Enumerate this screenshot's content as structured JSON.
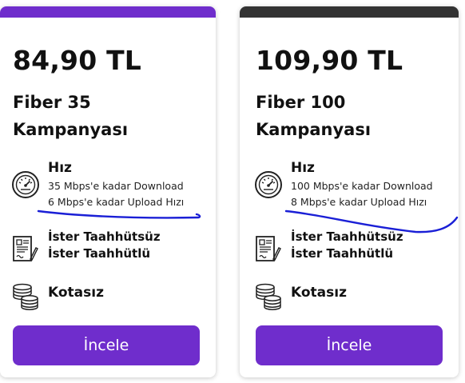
{
  "colors": {
    "accent": "#6f2dcc",
    "card2_topbar": "#333333",
    "annotation": "#1a1fd6"
  },
  "cards": [
    {
      "price": "84,90 TL",
      "title_line1": "Fiber 35",
      "title_line2": "Kampanyası",
      "speed": {
        "heading": "Hız",
        "download": "35 Mbps'e kadar Download",
        "upload": "6 Mbps'e kadar Upload Hızı"
      },
      "contract": {
        "line1": "İster Taahhütsüz",
        "line2": "İster Taahhütlü"
      },
      "quota": "Kotasız",
      "button": "İncele",
      "icons": [
        "speedometer-icon",
        "contract-icon",
        "coins-icon"
      ]
    },
    {
      "price": "109,90 TL",
      "title_line1": "Fiber 100",
      "title_line2": "Kampanyası",
      "speed": {
        "heading": "Hız",
        "download": "100 Mbps'e kadar Download",
        "upload": "8 Mbps'e kadar Upload Hızı"
      },
      "contract": {
        "line1": "İster Taahhütsüz",
        "line2": "İster Taahhütlü"
      },
      "quota": "Kotasız",
      "button": "İncele",
      "icons": [
        "speedometer-icon",
        "contract-icon",
        "coins-icon"
      ]
    }
  ]
}
